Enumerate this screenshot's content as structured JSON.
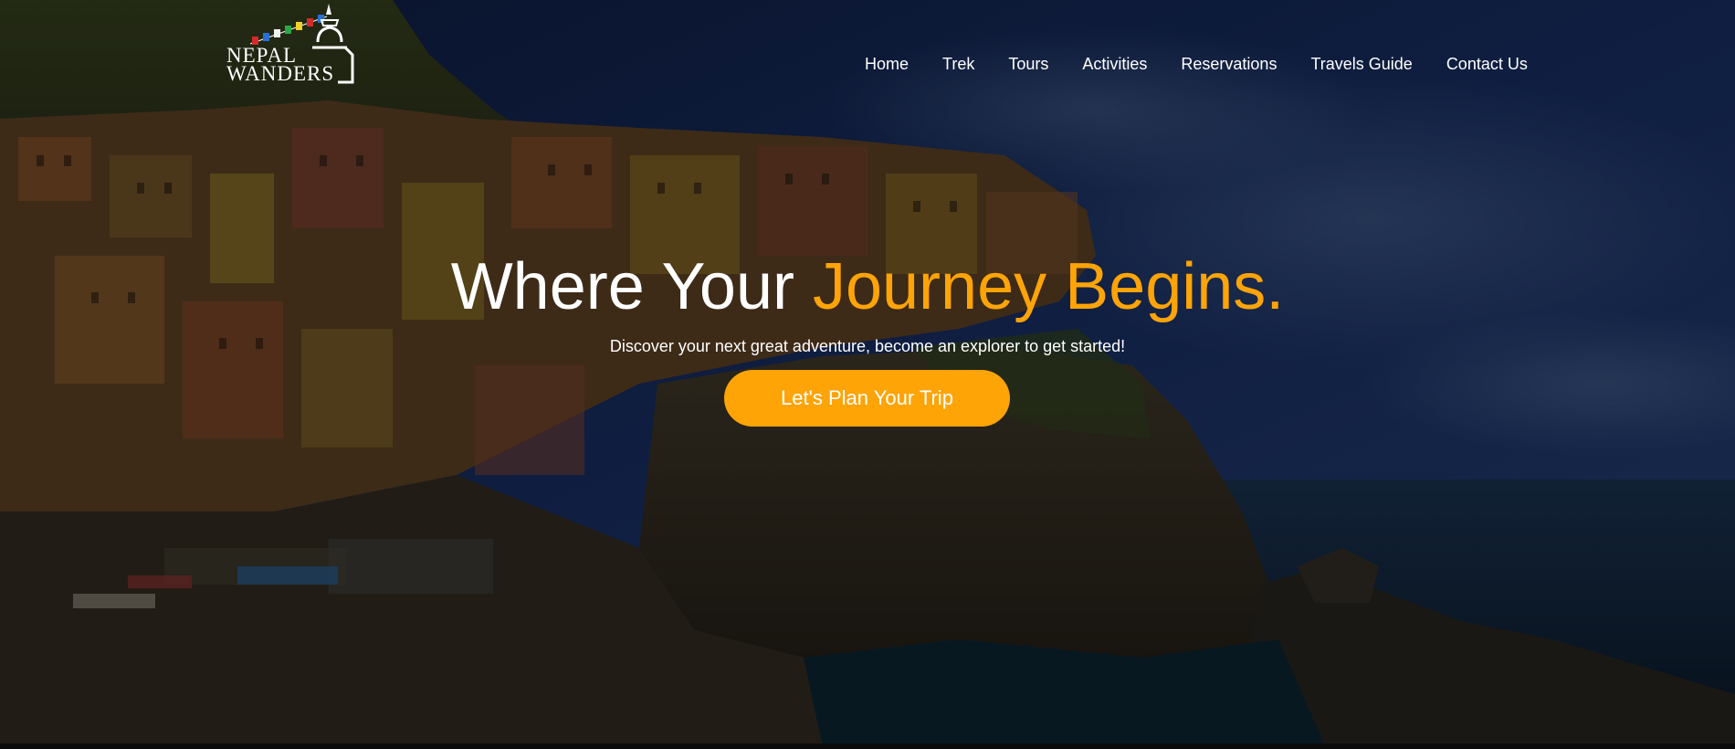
{
  "logo": {
    "line1": "NEPAL",
    "line2": "WANDERS",
    "flag_colors": [
      "#d32a2a",
      "#2a6fd3",
      "#f2f2f2",
      "#2aa845",
      "#f2d12a"
    ]
  },
  "nav": {
    "items": [
      "Home",
      "Trek",
      "Tours",
      "Activities",
      "Reservations",
      "Travels Guide",
      "Contact Us"
    ]
  },
  "hero": {
    "headline_part1": "Where Your ",
    "headline_part2": "Journey Begins.",
    "subline": "Discover your next great adventure, become an explorer to get started!",
    "cta_label": "Let's Plan Your Trip",
    "accent_color": "#ffa407",
    "background_image": "coastal-cliff-village-at-dusk"
  }
}
